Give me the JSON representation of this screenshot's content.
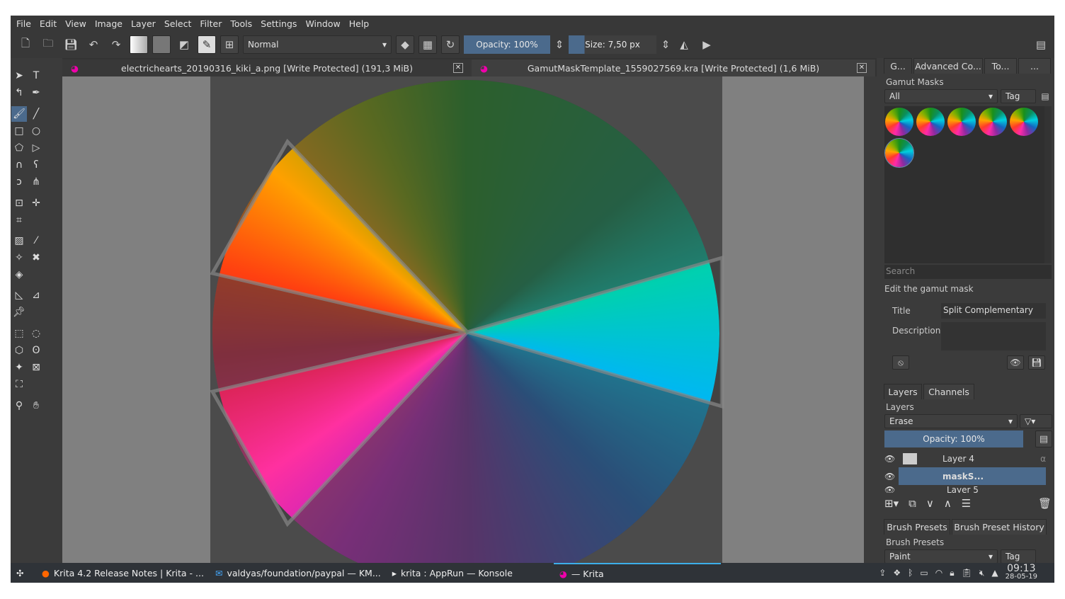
{
  "menu": [
    "File",
    "Edit",
    "View",
    "Image",
    "Layer",
    "Select",
    "Filter",
    "Tools",
    "Settings",
    "Window",
    "Help"
  ],
  "toolbar": {
    "blend_mode": "Normal",
    "opacity": "Opacity:  100%",
    "size": "Size:  7,50 px"
  },
  "documents": [
    {
      "title": "electrichearts_20190316_kiki_a.png [Write Protected]  (191,3 MiB)",
      "active": false
    },
    {
      "title": "GamutMaskTemplate_1559027569.kra [Write Protected]  (1,6 MiB)",
      "active": true
    }
  ],
  "docker_tabs": [
    "G...",
    "Advanced Co...",
    "To...",
    "..."
  ],
  "gamut_masks": {
    "title": "Gamut Masks",
    "filter": "All",
    "tag": "Tag",
    "search_placeholder": "Search",
    "edit_heading": "Edit the gamut mask",
    "title_label": "Title",
    "title_value": "Split Complementary",
    "description_label": "Description"
  },
  "layers_tabs": [
    "Layers",
    "Channels"
  ],
  "layers": {
    "title": "Layers",
    "blend": "Erase",
    "opacity": "Opacity:  100%",
    "items": [
      {
        "name": "Layer 4",
        "selected": false
      },
      {
        "name": "maskS...",
        "selected": true
      },
      {
        "name": "Layer 5",
        "selected": false
      }
    ]
  },
  "brush_tabs": [
    "Brush Presets",
    "Brush Preset History"
  ],
  "brush": {
    "title": "Brush Presets",
    "filter": "Paint",
    "tag": "Tag"
  },
  "taskbar": {
    "tasks": [
      "Krita 4.2 Release Notes | Krita - ...",
      "valdyas/foundation/paypal — KM...",
      "krita : AppRun — Konsole",
      "— Krita"
    ],
    "time": "09:13",
    "date": "28-05-19"
  },
  "colors": {
    "accent": "#4b6a8c",
    "bg": "#3b3b3b"
  }
}
